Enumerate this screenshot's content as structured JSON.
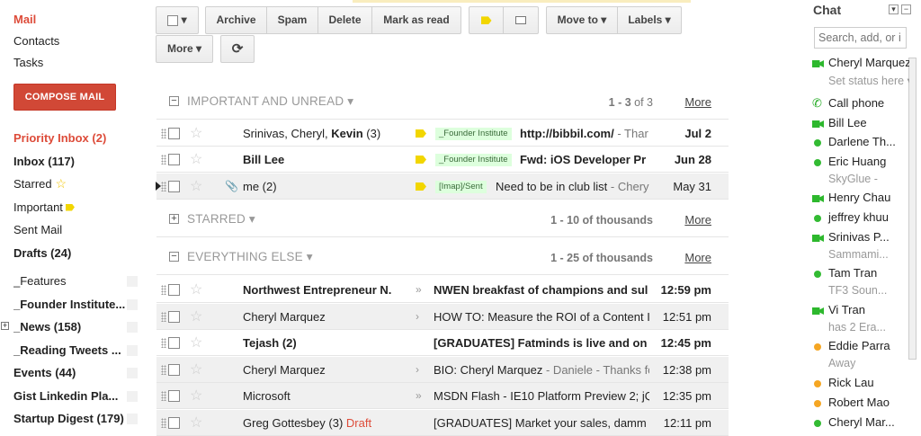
{
  "nav": {
    "mail": "Mail",
    "contacts": "Contacts",
    "tasks": "Tasks",
    "compose": "COMPOSE MAIL"
  },
  "labels": [
    {
      "text": "Priority Inbox (2)",
      "style": "pri"
    },
    {
      "text": "Inbox (117)",
      "style": "bold"
    },
    {
      "text": "Starred",
      "style": "normal"
    },
    {
      "text": "Important",
      "style": "normal"
    },
    {
      "text": "Sent Mail",
      "style": "normal"
    },
    {
      "text": "Drafts (24)",
      "style": "bold"
    },
    {
      "text": "_Features",
      "style": "normal"
    },
    {
      "text": "_Founder Institute...",
      "style": "bold"
    },
    {
      "text": "_News (158)",
      "style": "bold"
    },
    {
      "text": "_Reading Tweets ...",
      "style": "bold"
    },
    {
      "text": "Events (44)",
      "style": "bold"
    },
    {
      "text": "Gist Linkedin Pla...",
      "style": "bold"
    },
    {
      "text": "Startup Digest (179)",
      "style": "bold"
    }
  ],
  "toolbar": {
    "archive": "Archive",
    "spam": "Spam",
    "delete": "Delete",
    "mark_read": "Mark as read",
    "move_to": "Move to ▾",
    "labels": "Labels ▾",
    "more": "More ▾",
    "refresh": "⟳",
    "select": "▾"
  },
  "sections": [
    {
      "title": "IMPORTANT AND UNREAD ▾",
      "range": "1 - 3",
      "of": " of 3",
      "more": "More"
    },
    {
      "title": "STARRED ▾",
      "range": "1 - 10 of thousands",
      "of": "",
      "more": "More"
    },
    {
      "title": "EVERYTHING ELSE ▾",
      "range": "1 - 25 of thousands",
      "of": "",
      "more": "More"
    }
  ],
  "important_rows": [
    {
      "sender_a": "Srinivas, Cheryl, ",
      "sender_b": "Kevin",
      "sender_c": " (3)",
      "tag": "_Founder Institute",
      "subject": "http://bibbil.com/",
      "snippet": " - Thar",
      "date": "Jul 2",
      "unread": true
    },
    {
      "sender_a": "",
      "sender_b": "Bill Lee",
      "sender_c": "",
      "tag": "_Founder Institute",
      "subject": "Fwd: iOS Developer Pr",
      "snippet": "",
      "date": "Jun 28",
      "unread": true
    },
    {
      "sender_a": "me (2)",
      "sender_b": "",
      "sender_c": "",
      "tag": "[Imap]/Sent",
      "subject": "Need to be in club list",
      "snippet": " - Chery",
      "date": "May 31",
      "unread": false
    }
  ],
  "else_rows": [
    {
      "sender": "Northwest Entrepreneur N.",
      "imp": "»",
      "subject": "NWEN breakfast of champions and sul",
      "snippet": "",
      "date": "12:59 pm",
      "unread": true
    },
    {
      "sender": "Cheryl Marquez",
      "imp": "›",
      "subject": "HOW TO: Measure the ROI of a Content I",
      "snippet": "",
      "date": "12:51 pm",
      "unread": false
    },
    {
      "sender": "Tejash (2)",
      "imp": "",
      "subject": "[GRADUATES] Fatminds is live and on",
      "snippet": "",
      "date": "12:45 pm",
      "unread": true
    },
    {
      "sender": "Cheryl Marquez",
      "imp": "›",
      "subject": "BIO: Cheryl Marquez",
      "snippet": " - Daniele - Thanks fo",
      "date": "12:38 pm",
      "unread": false
    },
    {
      "sender": "Microsoft",
      "imp": "»",
      "subject": "MSDN Flash - IE10 Platform Preview 2; jQ",
      "snippet": "",
      "date": "12:35 pm",
      "unread": false
    },
    {
      "sender": "Greg Gottesbey (3)",
      "draft": "Draft",
      "imp": "",
      "subject": "[GRADUATES] Market your sales, damm",
      "snippet": "",
      "date": "12:11 pm",
      "unread": false
    }
  ],
  "chat": {
    "title": "Chat",
    "search_placeholder": "Search, add, or i",
    "contacts": [
      {
        "name": "Cheryl Marquez",
        "status": "Set status here ▾",
        "ind": "cam"
      },
      {
        "name": "Call phone",
        "status": "",
        "ind": "phone"
      },
      {
        "name": "Bill Lee",
        "status": "",
        "ind": "cam"
      },
      {
        "name": "Darlene Th...",
        "status": "",
        "ind": "dot"
      },
      {
        "name": "Eric Huang",
        "status": "SkyGlue - ",
        "ind": "dot"
      },
      {
        "name": "Henry Chau",
        "status": "",
        "ind": "cam"
      },
      {
        "name": "jeffrey khuu",
        "status": "",
        "ind": "dot"
      },
      {
        "name": "Srinivas P...",
        "status": "Sammami...",
        "ind": "cam"
      },
      {
        "name": "Tam Tran",
        "status": "TF3 Soun...",
        "ind": "dot"
      },
      {
        "name": "Vi Tran",
        "status": "has 2 Era...",
        "ind": "cam"
      },
      {
        "name": "Eddie Parra",
        "status": "Away",
        "ind": "idle"
      },
      {
        "name": "Rick Lau",
        "status": "",
        "ind": "idle"
      },
      {
        "name": "Robert Mao",
        "status": "",
        "ind": "idle"
      },
      {
        "name": "Cheryl Mar...",
        "status": "",
        "ind": "dot"
      }
    ]
  },
  "colors": {
    "accent": "#dd4b39",
    "compose": "#d14836",
    "online": "#33bb33",
    "idle": "#f5a623"
  }
}
